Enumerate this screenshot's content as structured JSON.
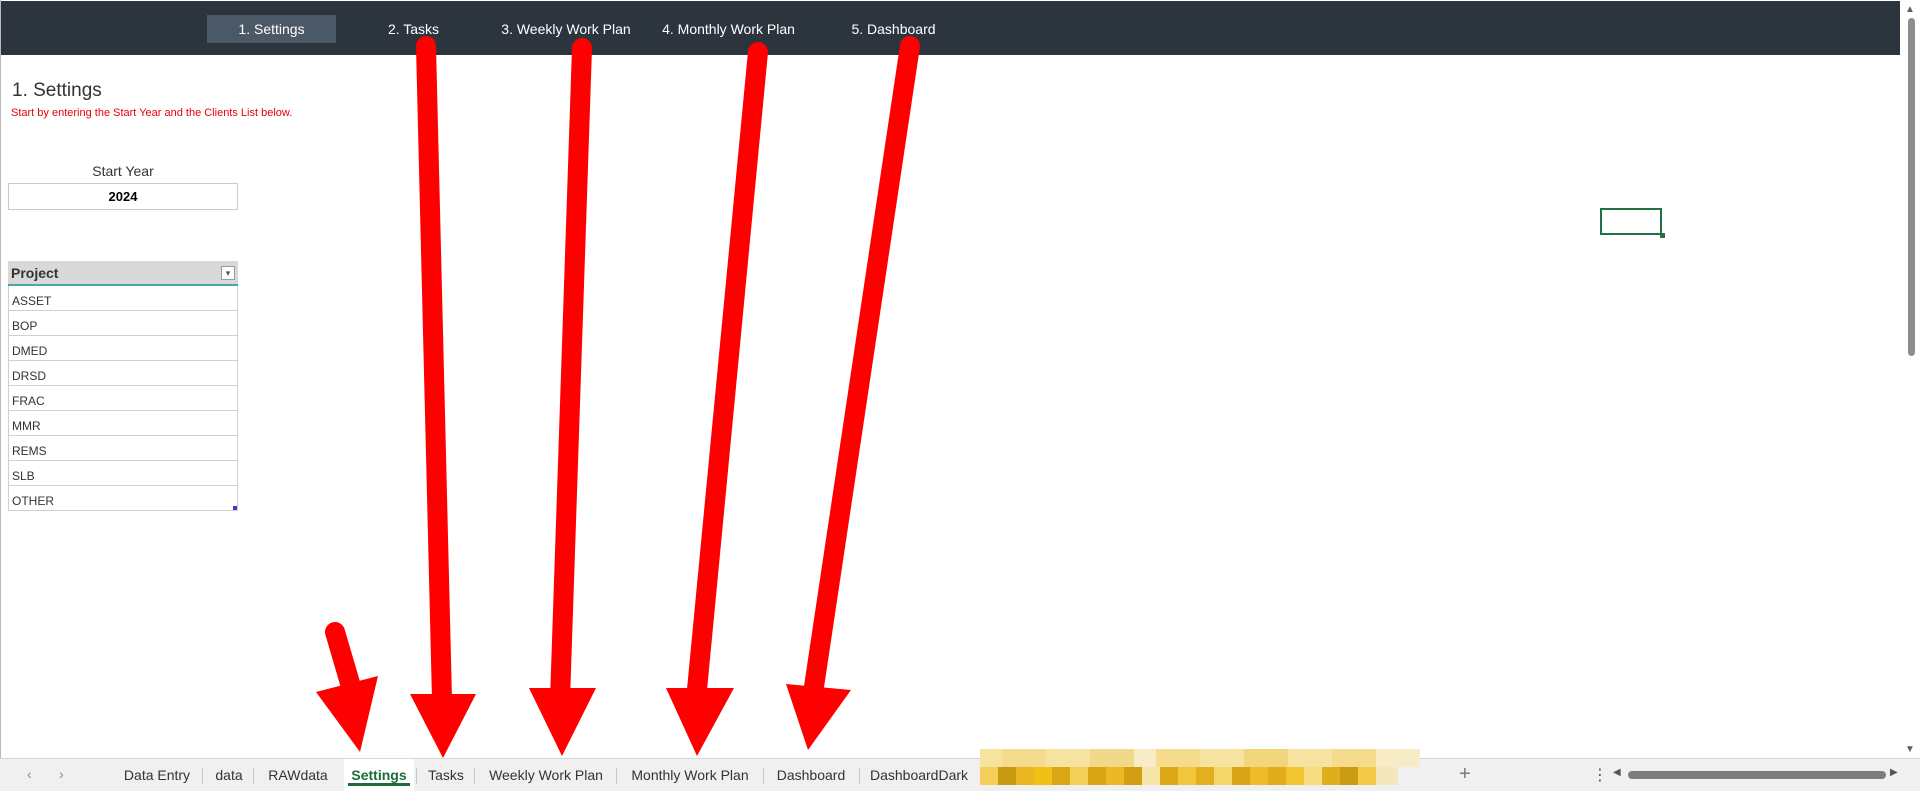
{
  "nav": {
    "buttons": [
      {
        "label": "1. Settings",
        "active": true
      },
      {
        "label": "2. Tasks",
        "active": false
      },
      {
        "label": "3. Weekly Work Plan",
        "active": false
      },
      {
        "label": "4. Monthly Work Plan",
        "active": false
      },
      {
        "label": "5. Dashboard",
        "active": false
      }
    ]
  },
  "main": {
    "title": "1. Settings",
    "hint": "Start by entering the Start Year and the Clients List below."
  },
  "start_year": {
    "label": "Start Year",
    "value": "2024"
  },
  "project_table": {
    "header": "Project",
    "rows": [
      "ASSET",
      "BOP",
      "DMED",
      "DRSD",
      "FRAC",
      "MMR",
      "REMS",
      "SLB",
      "OTHER"
    ]
  },
  "tabs": {
    "items": [
      {
        "label": "Data Entry",
        "active": false
      },
      {
        "label": "data",
        "active": false
      },
      {
        "label": "RAWdata",
        "active": false
      },
      {
        "label": "Settings",
        "active": true
      },
      {
        "label": "Tasks",
        "active": false
      },
      {
        "label": "Weekly Work Plan",
        "active": false
      },
      {
        "label": "Monthly Work Plan",
        "active": false
      },
      {
        "label": "Dashboard",
        "active": false
      },
      {
        "label": "DashboardDark",
        "active": false
      }
    ],
    "prev_icon": "‹",
    "next_icon": "›",
    "add_icon": "+",
    "more_icon": "⋮"
  },
  "icons": {
    "filter": "filter-dropdown-icon",
    "scroll_up": "▲",
    "scroll_down": "▼",
    "scroll_left": "◀",
    "scroll_right": "▶"
  },
  "colors": {
    "nav_bg": "#2c353e",
    "nav_active": "#4b5866",
    "hint_red": "#e8000a",
    "arrow_red": "#ff0000",
    "excel_green": "#1d6b39"
  }
}
